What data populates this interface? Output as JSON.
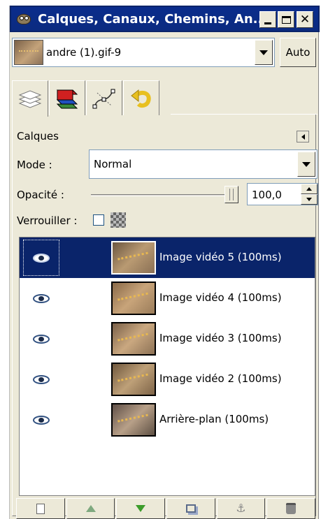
{
  "window": {
    "title": "Calques, Canaux, Chemins, An..."
  },
  "image_selector": {
    "value": "andre (1).gif-9",
    "auto_label": "Auto"
  },
  "tabs": [
    {
      "name": "layers",
      "icon": "layers-icon"
    },
    {
      "name": "channels",
      "icon": "channels-icon"
    },
    {
      "name": "paths",
      "icon": "paths-icon"
    },
    {
      "name": "undo",
      "icon": "undo-icon"
    }
  ],
  "layers_panel": {
    "title": "Calques",
    "mode_label": "Mode :",
    "mode_value": "Normal",
    "opacity_label": "Opacité :",
    "opacity_value": "100,0",
    "opacity_level": 1.0,
    "lock_label": "Verrouiller :",
    "lock_checked": false
  },
  "layers": [
    {
      "name": "Image vidéo 5 (100ms)",
      "visible": true,
      "selected": true
    },
    {
      "name": "Image vidéo 4 (100ms)",
      "visible": true,
      "selected": false
    },
    {
      "name": "Image vidéo 3 (100ms)",
      "visible": true,
      "selected": false
    },
    {
      "name": "Image vidéo 2 (100ms)",
      "visible": true,
      "selected": false
    },
    {
      "name": "Arrière-plan (100ms)",
      "visible": true,
      "selected": false
    }
  ],
  "bottom_toolbar": [
    {
      "icon": "new-layer-icon"
    },
    {
      "icon": "raise-layer-icon"
    },
    {
      "icon": "lower-layer-icon"
    },
    {
      "icon": "duplicate-layer-icon"
    },
    {
      "icon": "anchor-layer-icon"
    },
    {
      "icon": "delete-layer-icon"
    }
  ],
  "colors": {
    "titlebar": "#0a2c8c",
    "selection": "#0a246a",
    "face": "#ece9d8"
  }
}
